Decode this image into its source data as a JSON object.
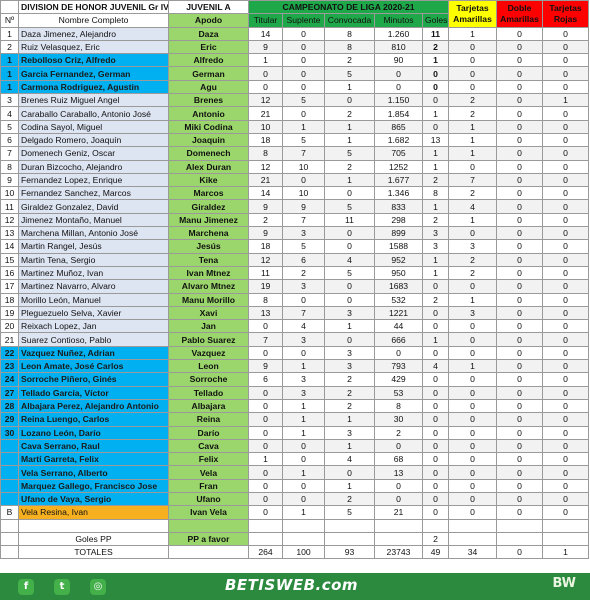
{
  "header": {
    "title": "DIVISION DE HONOR JUVENIL Gr IV",
    "team": "JUVENIL A",
    "championship": "CAMPEONATO  DE LIGA 2020-21"
  },
  "columns": {
    "no": "Nº",
    "name": "Nombre Completo",
    "apodo": "Apodo",
    "titular": "Titular",
    "suplente": "Suplente",
    "convocada": "Convocada",
    "minutos": "Minutos",
    "goles": "Goles",
    "ta": "Tarjetas Amarillas",
    "da": "Doble Amarillas",
    "tr": "Tarjetas Rojas"
  },
  "colors": {
    "header_green": "#1fa84a",
    "apodo_green": "#9bd66c",
    "name_light": "#dde4f2",
    "name_blue": "#00b0f0",
    "name_orange": "#f7b120",
    "yellow": "#ffff00",
    "red": "#ff0000"
  },
  "players": [
    {
      "no": "1",
      "name": "Daza Jimenez, Alejandro",
      "apodo": "Daza",
      "tit": "14",
      "sup": "0",
      "conv": "8",
      "min": "1.260",
      "gol": "11",
      "ta": "1",
      "da": "0",
      "tr": "0",
      "style": "w",
      "gred": true
    },
    {
      "no": "2",
      "name": "Ruiz Velasquez, Eric",
      "apodo": "Eric",
      "tit": "9",
      "sup": "0",
      "conv": "8",
      "min": "810",
      "gol": "2",
      "ta": "0",
      "da": "0",
      "tr": "0",
      "style": "w",
      "gred": true
    },
    {
      "no": "1",
      "name": "Rebolloso Criz, Alfredo",
      "apodo": "Alfredo",
      "tit": "1",
      "sup": "0",
      "conv": "2",
      "min": "90",
      "gol": "1",
      "ta": "0",
      "da": "0",
      "tr": "0",
      "style": "b",
      "gred": true
    },
    {
      "no": "1",
      "name": "Garcia Fernandez, German",
      "apodo": "German",
      "tit": "0",
      "sup": "0",
      "conv": "5",
      "min": "0",
      "gol": "0",
      "ta": "0",
      "da": "0",
      "tr": "0",
      "style": "b",
      "gred": true
    },
    {
      "no": "1",
      "name": "Carmona Rodriguez, Agustin",
      "apodo": "Agu",
      "tit": "0",
      "sup": "0",
      "conv": "1",
      "min": "0",
      "gol": "0",
      "ta": "0",
      "da": "0",
      "tr": "0",
      "style": "b",
      "gred": true
    },
    {
      "no": "3",
      "name": "Brenes Ruiz Miguel Angel",
      "apodo": "Brenes",
      "tit": "12",
      "sup": "5",
      "conv": "0",
      "min": "1.150",
      "gol": "0",
      "ta": "2",
      "da": "0",
      "tr": "1",
      "style": "w"
    },
    {
      "no": "4",
      "name": "Caraballo Caraballo, Antonio José",
      "apodo": "Antonio",
      "tit": "21",
      "sup": "0",
      "conv": "2",
      "min": "1.854",
      "gol": "1",
      "ta": "2",
      "da": "0",
      "tr": "0",
      "style": "w"
    },
    {
      "no": "5",
      "name": "Codina Sayol, Miguel",
      "apodo": "Miki Codina",
      "tit": "10",
      "sup": "1",
      "conv": "1",
      "min": "865",
      "gol": "0",
      "ta": "1",
      "da": "0",
      "tr": "0",
      "style": "w"
    },
    {
      "no": "6",
      "name": "Delgado Romero, Joaquín",
      "apodo": "Joaquin",
      "tit": "18",
      "sup": "5",
      "conv": "1",
      "min": "1.682",
      "gol": "13",
      "ta": "1",
      "da": "0",
      "tr": "0",
      "style": "w"
    },
    {
      "no": "7",
      "name": "Domenech Geniz, Oscar",
      "apodo": "Domenech",
      "tit": "8",
      "sup": "7",
      "conv": "5",
      "min": "705",
      "gol": "1",
      "ta": "1",
      "da": "0",
      "tr": "0",
      "style": "w"
    },
    {
      "no": "8",
      "name": "Duran Bizcocho, Alejandro",
      "apodo": "Alex Duran",
      "tit": "12",
      "sup": "10",
      "conv": "2",
      "min": "1252",
      "gol": "1",
      "ta": "0",
      "da": "0",
      "tr": "0",
      "style": "w"
    },
    {
      "no": "9",
      "name": "Fernandez Lopez, Enrique",
      "apodo": "Kike",
      "tit": "21",
      "sup": "0",
      "conv": "1",
      "min": "1.677",
      "gol": "2",
      "ta": "7",
      "da": "0",
      "tr": "0",
      "style": "w"
    },
    {
      "no": "10",
      "name": "Fernandez Sanchez, Marcos",
      "apodo": "Marcos",
      "tit": "14",
      "sup": "10",
      "conv": "0",
      "min": "1.346",
      "gol": "8",
      "ta": "2",
      "da": "0",
      "tr": "0",
      "style": "w"
    },
    {
      "no": "11",
      "name": "Giraldez Gonzalez, David",
      "apodo": "Giraldez",
      "tit": "9",
      "sup": "9",
      "conv": "5",
      "min": "833",
      "gol": "1",
      "ta": "4",
      "da": "0",
      "tr": "0",
      "style": "w",
      "tahi": true
    },
    {
      "no": "12",
      "name": "Jimenez  Montaño, Manuel",
      "apodo": "Manu Jimenez",
      "tit": "2",
      "sup": "7",
      "conv": "11",
      "min": "298",
      "gol": "2",
      "ta": "1",
      "da": "0",
      "tr": "0",
      "style": "w"
    },
    {
      "no": "13",
      "name": "Marchena Millan, Antonio José",
      "apodo": "Marchena",
      "tit": "9",
      "sup": "3",
      "conv": "0",
      "min": "899",
      "gol": "3",
      "ta": "0",
      "da": "0",
      "tr": "0",
      "style": "w"
    },
    {
      "no": "14",
      "name": "Martin Rangel, Jesús",
      "apodo": "Jesús",
      "tit": "18",
      "sup": "5",
      "conv": "0",
      "min": "1588",
      "gol": "3",
      "ta": "3",
      "da": "0",
      "tr": "0",
      "style": "w"
    },
    {
      "no": "15",
      "name": "Martin Tena, Sergio",
      "apodo": "Tena",
      "tit": "12",
      "sup": "6",
      "conv": "4",
      "min": "952",
      "gol": "1",
      "ta": "2",
      "da": "0",
      "tr": "0",
      "style": "w"
    },
    {
      "no": "16",
      "name": "Martinez Muñoz, Ivan",
      "apodo": "Ivan Mtnez",
      "tit": "11",
      "sup": "2",
      "conv": "5",
      "min": "950",
      "gol": "1",
      "ta": "2",
      "da": "0",
      "tr": "0",
      "style": "w"
    },
    {
      "no": "17",
      "name": "Martinez Navarro, Alvaro",
      "apodo": "Alvaro Mtnez",
      "tit": "19",
      "sup": "3",
      "conv": "0",
      "min": "1683",
      "gol": "0",
      "ta": "0",
      "da": "0",
      "tr": "0",
      "style": "w"
    },
    {
      "no": "18",
      "name": "Morillo León, Manuel",
      "apodo": "Manu Morillo",
      "tit": "8",
      "sup": "0",
      "conv": "0",
      "min": "532",
      "gol": "2",
      "ta": "1",
      "da": "0",
      "tr": "0",
      "style": "w"
    },
    {
      "no": "19",
      "name": "Pleguezuelo Selva, Xavier",
      "apodo": "Xavi",
      "tit": "13",
      "sup": "7",
      "conv": "3",
      "min": "1221",
      "gol": "0",
      "ta": "3",
      "da": "0",
      "tr": "0",
      "style": "w"
    },
    {
      "no": "20",
      "name": "Reixach Lopez, Jan",
      "apodo": "Jan",
      "tit": "0",
      "sup": "4",
      "conv": "1",
      "min": "44",
      "gol": "0",
      "ta": "0",
      "da": "0",
      "tr": "0",
      "style": "w"
    },
    {
      "no": "21",
      "name": "Suarez Contioso, Pablo",
      "apodo": "Pablo Suarez",
      "tit": "7",
      "sup": "3",
      "conv": "0",
      "min": "666",
      "gol": "1",
      "ta": "0",
      "da": "0",
      "tr": "0",
      "style": "w"
    },
    {
      "no": "22",
      "name": "Vazquez Nuñez, Adrian",
      "apodo": "Vazquez",
      "tit": "0",
      "sup": "0",
      "conv": "3",
      "min": "0",
      "gol": "0",
      "ta": "0",
      "da": "0",
      "tr": "0",
      "style": "b"
    },
    {
      "no": "23",
      "name": "Leon Amate, José Carlos",
      "apodo": "Leon",
      "tit": "9",
      "sup": "1",
      "conv": "3",
      "min": "793",
      "gol": "4",
      "ta": "1",
      "da": "0",
      "tr": "0",
      "style": "b"
    },
    {
      "no": "24",
      "name": "Sorroche Piñero, Ginés",
      "apodo": "Sorroche",
      "tit": "6",
      "sup": "3",
      "conv": "2",
      "min": "429",
      "gol": "0",
      "ta": "0",
      "da": "0",
      "tr": "0",
      "style": "b"
    },
    {
      "no": "27",
      "name": "Tellado García, Víctor",
      "apodo": "Tellado",
      "tit": "0",
      "sup": "3",
      "conv": "2",
      "min": "53",
      "gol": "0",
      "ta": "0",
      "da": "0",
      "tr": "0",
      "style": "b"
    },
    {
      "no": "28",
      "name": "Albajara Perez, Alejandro Antonio",
      "apodo": "Albajara",
      "tit": "0",
      "sup": "1",
      "conv": "2",
      "min": "8",
      "gol": "0",
      "ta": "0",
      "da": "0",
      "tr": "0",
      "style": "b"
    },
    {
      "no": "29",
      "name": "Reina Luengo, Carlos",
      "apodo": "Reina",
      "tit": "0",
      "sup": "1",
      "conv": "1",
      "min": "30",
      "gol": "0",
      "ta": "0",
      "da": "0",
      "tr": "0",
      "style": "b"
    },
    {
      "no": "30",
      "name": "Lozano León, Darío",
      "apodo": "Darío",
      "tit": "0",
      "sup": "1",
      "conv": "3",
      "min": "2",
      "gol": "0",
      "ta": "0",
      "da": "0",
      "tr": "0",
      "style": "b"
    },
    {
      "no": "",
      "name": "Cava Serrano, Raul",
      "apodo": "Cava",
      "tit": "0",
      "sup": "0",
      "conv": "1",
      "min": "0",
      "gol": "0",
      "ta": "0",
      "da": "0",
      "tr": "0",
      "style": "b"
    },
    {
      "no": "",
      "name": "Martí  Garreta, Felix",
      "apodo": "Felix",
      "tit": "1",
      "sup": "0",
      "conv": "4",
      "min": "68",
      "gol": "0",
      "ta": "0",
      "da": "0",
      "tr": "0",
      "style": "b"
    },
    {
      "no": "",
      "name": "Vela Serrano, Alberto",
      "apodo": "Vela",
      "tit": "0",
      "sup": "1",
      "conv": "0",
      "min": "13",
      "gol": "0",
      "ta": "0",
      "da": "0",
      "tr": "0",
      "style": "b"
    },
    {
      "no": "",
      "name": "Marquez Gallego, Francisco Jose",
      "apodo": "Fran",
      "tit": "0",
      "sup": "0",
      "conv": "1",
      "min": "0",
      "gol": "0",
      "ta": "0",
      "da": "0",
      "tr": "0",
      "style": "b"
    },
    {
      "no": "",
      "name": "Ufano de Vaya, Sergio",
      "apodo": "Ufano",
      "tit": "0",
      "sup": "0",
      "conv": "2",
      "min": "0",
      "gol": "0",
      "ta": "0",
      "da": "0",
      "tr": "0",
      "style": "b"
    },
    {
      "no": "B",
      "name": "Vela Resina, Ivan",
      "apodo": "Ivan Vela",
      "tit": "0",
      "sup": "1",
      "conv": "5",
      "min": "21",
      "gol": "0",
      "ta": "0",
      "da": "0",
      "tr": "0",
      "style": "o"
    }
  ],
  "goles_pp": {
    "label": "Goles PP",
    "apodo": "PP a favor",
    "gol": "2"
  },
  "totales": {
    "label": "TOTALES",
    "tit": "264",
    "sup": "100",
    "conv": "93",
    "min": "23743",
    "gol": "49",
    "ta": "34",
    "da": "0",
    "tr": "1"
  },
  "footer": {
    "brand": "BETISWEB.com",
    "logo": "BW",
    "social_icons": [
      "facebook-icon",
      "twitter-icon",
      "instagram-icon"
    ]
  }
}
